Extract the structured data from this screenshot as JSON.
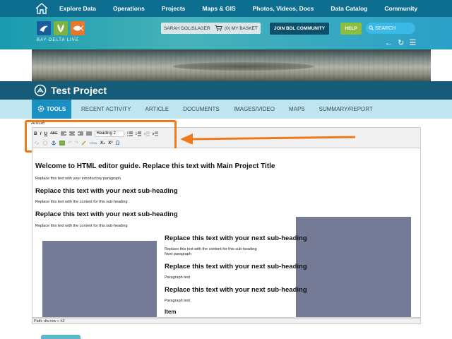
{
  "topnav": {
    "items": [
      "Explore Data",
      "Operations",
      "Projects",
      "Maps & GIS",
      "Photos, Videos, Docs",
      "Data Catalog",
      "Community"
    ]
  },
  "header": {
    "logo_text": "BAY-DELTA LIVE",
    "user": "SARAH DOLISLAGER",
    "basket": "(0) MY BASKET",
    "join": "JOIN BDL COMMUNITY",
    "help": "HELP",
    "search_placeholder": "SEARCH",
    "icons": [
      "back-arrow",
      "refresh",
      "menu"
    ]
  },
  "project": {
    "title": "Test Project"
  },
  "tabs": {
    "active": "TOOLS",
    "items": [
      "RECENT ACTIVITY",
      "ARTICLE",
      "DOCUMENTS",
      "IMAGES/VIDEO",
      "MAPS",
      "SUMMARY/REPORT"
    ]
  },
  "editor": {
    "label": "Article",
    "format_select": "Heading 2",
    "toolbar_row1": [
      "B",
      "I",
      "U",
      "ABC"
    ],
    "toolbar_row2_text": [
      "HTML",
      "X₂",
      "X²",
      "Ω"
    ],
    "content": {
      "h1": "Welcome to HTML editor guide. Replace this text with Main Project Title",
      "intro": "Replace this text with your introductory paragraph",
      "h2_1": "Replace this text with your next sub-heading",
      "p_1": "Replace this text with the content for this sub-heading",
      "h2_2": "Replace this text with your next sub-heading",
      "p_2": "Replace this text with the content for this sub-heading",
      "h2_3": "Replace this text with your next sub-heading",
      "p_3": "Replace this text with the content for this sub-heading",
      "p_3b": "Next paragraph",
      "h2_4": "Replace this text with your next sub-heading",
      "p_4": "Paragraph text",
      "h2_5": "Replace this text with your next sub-heading",
      "p_5": "Paragraph text",
      "h3": "Item"
    },
    "path": "Path: div.row » h2"
  },
  "colors": {
    "nav_bg": "#0e6e8f",
    "title_bar": "#155c78",
    "tab_bar": "#bfe6f0",
    "active_tab": "#1a8fc2",
    "highlight": "#f07a1a",
    "image_placeholder": "#757a97"
  }
}
